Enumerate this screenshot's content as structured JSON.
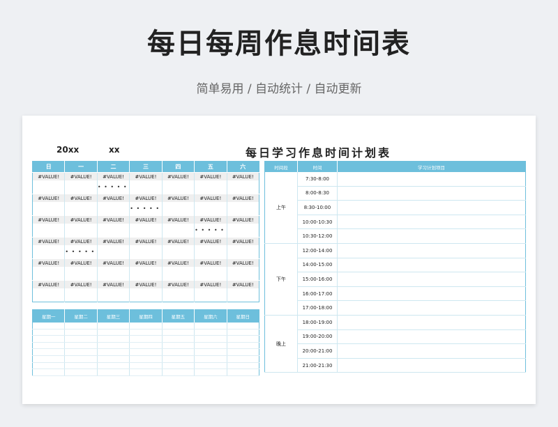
{
  "header": {
    "title": "每日每周作息时间表",
    "subtitle": "简单易用 / 自动统计 / 自动更新"
  },
  "sheet": {
    "year": "20xx",
    "month": "xx",
    "plan_title": "每日学习作息时间计划表"
  },
  "calendar": {
    "weekdays": [
      "日",
      "一",
      "二",
      "三",
      "四",
      "五",
      "六"
    ],
    "cell_value": "#VALUE!",
    "rows": 6
  },
  "weekly": {
    "headers": [
      "星期一",
      "星期二",
      "星期三",
      "星期四",
      "星期五",
      "星期六",
      "星期日"
    ]
  },
  "plan": {
    "headers": [
      "时间段",
      "时间",
      "学习计划项目"
    ],
    "periods": [
      {
        "name": "上午",
        "slots": [
          "7:30-8:00",
          "8:00-8:30",
          "8:30-10:00",
          "10:00-10:30",
          "10:30-12:00"
        ]
      },
      {
        "name": "下午",
        "slots": [
          "12:00-14:00",
          "14:00-15:00",
          "15:00-16:00",
          "16:00-17:00",
          "17:00-18:00"
        ]
      },
      {
        "name": "晚上",
        "slots": [
          "18:00-19:00",
          "19:00-20:00",
          "20:00-21:00",
          "21:00-21:30"
        ]
      }
    ]
  }
}
